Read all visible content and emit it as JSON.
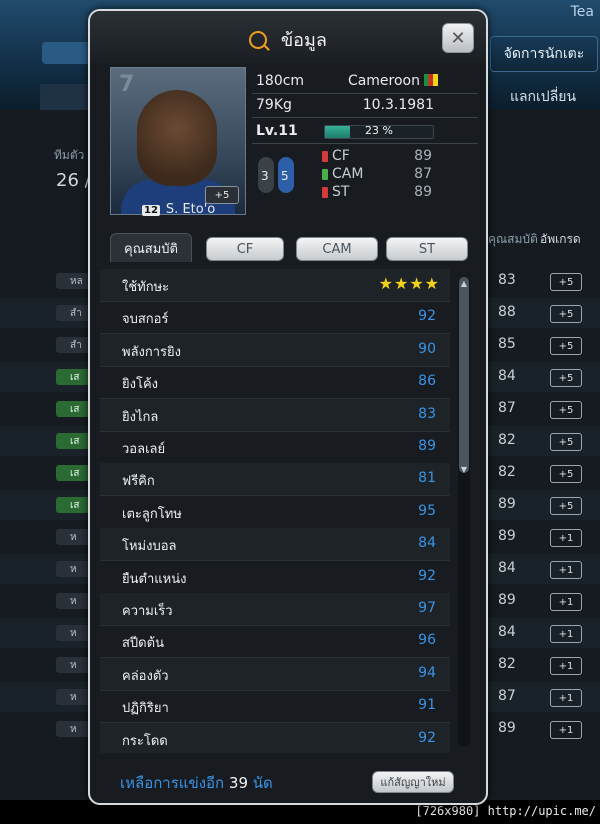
{
  "background": {
    "top_right_text": "Tea",
    "tab_manage_players": "จัดการนักเตะ",
    "tab_trade": "แลกเปลี่ยน",
    "team_label": "ทีมตัว",
    "count": "26 /",
    "col_attr": "คุณสมบัติ",
    "col_upgrade": "อัพเกรด",
    "rows": [
      {
        "pill": "หล",
        "pill_style": "dark",
        "value": "83",
        "badge": "+5"
      },
      {
        "pill": "สำ",
        "pill_style": "dark",
        "value": "88",
        "badge": "+5"
      },
      {
        "pill": "สำ",
        "pill_style": "dark",
        "value": "85",
        "badge": "+5"
      },
      {
        "pill": "เส",
        "pill_style": "green",
        "value": "84",
        "badge": "+5"
      },
      {
        "pill": "เส",
        "pill_style": "green",
        "value": "87",
        "badge": "+5"
      },
      {
        "pill": "เส",
        "pill_style": "green",
        "value": "82",
        "badge": "+5"
      },
      {
        "pill": "เส",
        "pill_style": "green",
        "value": "82",
        "badge": "+5"
      },
      {
        "pill": "เส",
        "pill_style": "green",
        "value": "89",
        "badge": "+5"
      },
      {
        "pill": "ห",
        "pill_style": "dark",
        "value": "89",
        "badge": "+1"
      },
      {
        "pill": "ห",
        "pill_style": "dark",
        "value": "84",
        "badge": "+1"
      },
      {
        "pill": "ห",
        "pill_style": "dark",
        "value": "89",
        "badge": "+1"
      },
      {
        "pill": "ห",
        "pill_style": "dark",
        "value": "84",
        "badge": "+1"
      },
      {
        "pill": "ห",
        "pill_style": "dark",
        "value": "82",
        "badge": "+1"
      },
      {
        "pill": "ห",
        "pill_style": "dark",
        "value": "87",
        "badge": "+1"
      },
      {
        "pill": "ห",
        "pill_style": "dark",
        "value": "89",
        "badge": "+1"
      }
    ],
    "footer_watermark": "[726x980] http://upic.me/"
  },
  "popup": {
    "title": "ข้อมูล",
    "close_glyph": "✕",
    "player": {
      "photo_number": "7",
      "photo_plus": "+5",
      "squad_number": "12",
      "name": "S. Eto'o",
      "height": "180cm",
      "weight": "79Kg",
      "country": "Cameroon",
      "birthdate": "10.3.1981",
      "level": "Lv.11",
      "xp_percent": "23 %",
      "xp_fraction": 0.23,
      "foot_left": "3",
      "foot_right": "5"
    },
    "positions": [
      {
        "name": "CF",
        "value": "89",
        "color": "#d33a3a"
      },
      {
        "name": "CAM",
        "value": "87",
        "color": "#49b04a"
      },
      {
        "name": "ST",
        "value": "89",
        "color": "#d33a3a"
      }
    ],
    "tabs": [
      "คุณสมบัติ",
      "CF",
      "CAM",
      "ST"
    ],
    "attributes": [
      {
        "label": "ใช้ทักษะ",
        "value": "★★★★",
        "stars": true
      },
      {
        "label": "จบสกอร์",
        "value": "92"
      },
      {
        "label": "พลังการยิง",
        "value": "90"
      },
      {
        "label": "ยิงโค้ง",
        "value": "86"
      },
      {
        "label": "ยิงไกล",
        "value": "83"
      },
      {
        "label": "วอลเลย์",
        "value": "89"
      },
      {
        "label": "ฟรีคิก",
        "value": "81"
      },
      {
        "label": "เตะลูกโทษ",
        "value": "95"
      },
      {
        "label": "โหม่งบอล",
        "value": "84"
      },
      {
        "label": "ยืนตำแหน่ง",
        "value": "92"
      },
      {
        "label": "ความเร็ว",
        "value": "97"
      },
      {
        "label": "สปีดต้น",
        "value": "96"
      },
      {
        "label": "คล่องตัว",
        "value": "94"
      },
      {
        "label": "ปฏิกิริยา",
        "value": "91"
      },
      {
        "label": "กระโดด",
        "value": "92"
      }
    ],
    "footer": {
      "prefix": "เหลือการแข่งอีก",
      "matches": "39",
      "suffix": "นัด",
      "renew_button": "แก้สัญญาใหม่"
    }
  }
}
